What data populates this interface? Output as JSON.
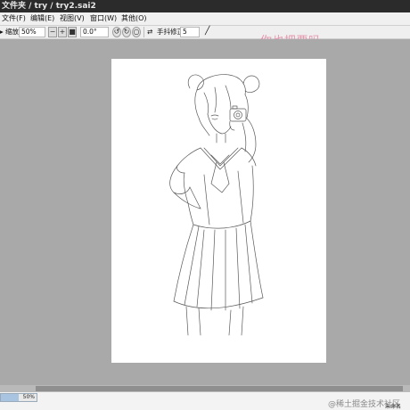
{
  "window": {
    "title": "文件夹 / try / try2.sai2"
  },
  "menu": {
    "items": [
      "文件(F)",
      "编辑(E)",
      "视图(V)",
      "窗口(W)",
      "其他(O)"
    ]
  },
  "toolbar": {
    "zoom_label": "缩放",
    "zoom_value": "50%",
    "rotate_value": "0.0°",
    "stabilizer_label": "手抖修正",
    "stabilizer_value": "5"
  },
  "watermark": "你也把要吗",
  "statusbar": {
    "memory_percent": 50,
    "memory_text": "50%",
    "credit": "@稀土掘金技术社区",
    "label2": "未命名"
  },
  "colors": {
    "canvas_bg": "#a9a9a9",
    "paper": "#ffffff",
    "titlebar": "#2b2b2b",
    "watermark": "#e58aa5"
  }
}
